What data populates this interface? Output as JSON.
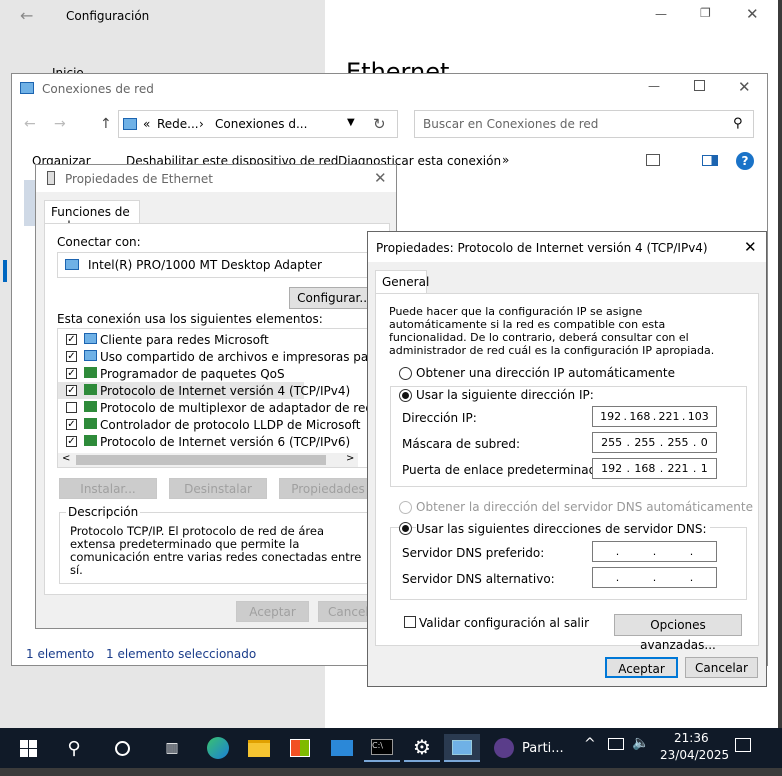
{
  "settings": {
    "title": "Configuración",
    "nav_home": "Inicio",
    "page_heading": "Ethernet"
  },
  "explorer": {
    "title": "Conexiones de red",
    "crumb1": "Rede...",
    "crumb2": "Conexiones d...",
    "search_placeholder": "Buscar en Conexiones de red",
    "menu": [
      "Organizar",
      "Deshabilitar este dispositivo de red",
      "Diagnosticar esta conexión"
    ],
    "more": "»",
    "status_count": "1 elemento",
    "status_selected": "1 elemento seleccionado"
  },
  "props": {
    "title": "Propiedades de Ethernet",
    "tab": "Funciones de red",
    "connect_label": "Conectar con:",
    "adapter": "Intel(R) PRO/1000 MT Desktop Adapter",
    "configure": "Configurar...",
    "items_label": "Esta conexión usa los siguientes elementos:",
    "items": [
      {
        "label": "Cliente para redes Microsoft",
        "checked": true
      },
      {
        "label": "Uso compartido de archivos e impresoras para redes M",
        "checked": true
      },
      {
        "label": "Programador de paquetes QoS",
        "checked": true
      },
      {
        "label": "Protocolo de Internet versión 4 (TCP/IPv4)",
        "checked": true
      },
      {
        "label": "Protocolo de multiplexor de adaptador de red de Micros",
        "checked": false
      },
      {
        "label": "Controlador de protocolo LLDP de Microsoft",
        "checked": true
      },
      {
        "label": "Protocolo de Internet versión 6 (TCP/IPv6)",
        "checked": true
      }
    ],
    "install": "Instalar...",
    "uninstall": "Desinstalar",
    "properties": "Propiedades",
    "desc_title": "Descripción",
    "desc_text": "Protocolo TCP/IP. El protocolo de red de área extensa predeterminado que permite la comunicación entre varias redes conectadas entre sí.",
    "accept": "Aceptar",
    "cancel": "Cancelar"
  },
  "ipv4": {
    "title": "Propiedades: Protocolo de Internet versión 4 (TCP/IPv4)",
    "tab": "General",
    "intro": "Puede hacer que la configuración IP se asigne automáticamente si la red es compatible con esta funcionalidad. De lo contrario, deberá consultar con el administrador de red cuál es la configuración IP apropiada.",
    "auto_ip": "Obtener una dirección IP automáticamente",
    "manual_ip": "Usar la siguiente dirección IP:",
    "ip_label": "Dirección IP:",
    "ip": [
      "192",
      "168",
      "221",
      "103"
    ],
    "mask_label": "Máscara de subred:",
    "mask": [
      "255",
      "255",
      "255",
      "0"
    ],
    "gw_label": "Puerta de enlace predeterminada:",
    "gw": [
      "192",
      "168",
      "221",
      "1"
    ],
    "auto_dns": "Obtener la dirección del servidor DNS automáticamente",
    "manual_dns": "Usar las siguientes direcciones de servidor DNS:",
    "dns1_label": "Servidor DNS preferido:",
    "dns2_label": "Servidor DNS alternativo:",
    "validate": "Validar configuración al salir",
    "advanced": "Opciones avanzadas...",
    "accept": "Aceptar",
    "cancel": "Cancelar"
  },
  "taskbar": {
    "app_label": "Parti...",
    "time": "21:36",
    "date": "23/04/2025"
  }
}
